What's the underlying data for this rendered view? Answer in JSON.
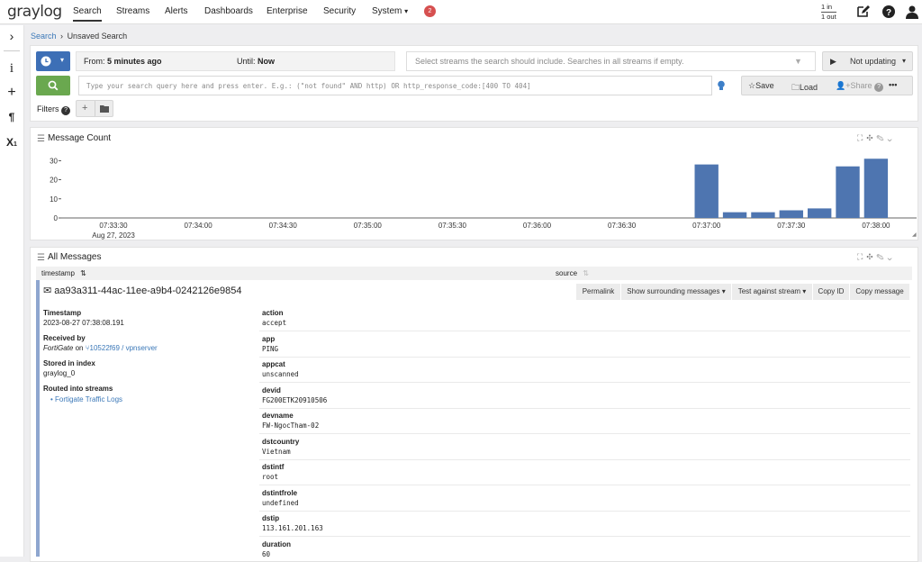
{
  "nav": {
    "logo": "graylog",
    "links": [
      "Search",
      "Streams",
      "Alerts",
      "Dashboards",
      "Enterprise",
      "Security",
      "System"
    ],
    "system_caret": "▾",
    "badge": "2",
    "throughput_in": "1 in",
    "throughput_out": "1 out"
  },
  "breadcrumb": {
    "root": "Search",
    "sep": "›",
    "current": "Unsaved Search"
  },
  "search": {
    "time_from_label": "From:",
    "time_from_value": "5 minutes ago",
    "time_until_label": "Until:",
    "time_until_value": "Now",
    "streams_placeholder": "Select streams the search should include. Searches in all streams if empty.",
    "refresh_label": "Not updating",
    "query_placeholder": "Type your search query here and press enter. E.g.: (\"not found\" AND http) OR http_response_code:[400 TO 404]",
    "save_label": "Save",
    "load_label": "Load",
    "share_label": "Share",
    "more_label": "•••",
    "filters_label": "Filters",
    "add_filter": "+"
  },
  "message_count": {
    "title": "Message Count"
  },
  "chart_data": {
    "type": "bar",
    "title": "Message Count",
    "xlabel": "",
    "ylabel": "",
    "ylim": [
      0,
      33
    ],
    "y_ticks": [
      "0",
      "10",
      "20",
      "30"
    ],
    "x_ticks": [
      "07:33:30",
      "07:34:00",
      "07:34:30",
      "07:35:00",
      "07:35:30",
      "07:36:00",
      "07:36:30",
      "07:37:00",
      "07:37:30",
      "07:38:00"
    ],
    "x_date_label": "Aug 27, 2023",
    "categories": [
      "07:37:00",
      "07:37:10",
      "07:37:20",
      "07:37:30",
      "07:37:40",
      "07:37:50",
      "07:38:00"
    ],
    "values": [
      28,
      3,
      3,
      4,
      5,
      27,
      31
    ],
    "grid": false,
    "color": "#4e75b0"
  },
  "messages": {
    "title": "All Messages",
    "col_timestamp": "timestamp",
    "col_source": "source",
    "message_id": "aa93a311-44ac-11ee-a9b4-0242126e9854",
    "actions": [
      "Permalink",
      "Show surrounding messages ▾",
      "Test against stream ▾",
      "Copy ID",
      "Copy message"
    ],
    "meta": {
      "timestamp_label": "Timestamp",
      "timestamp_value": "2023-08-27 07:38:08.191",
      "received_label": "Received by",
      "received_input": "FortiGate",
      "received_on": "on",
      "received_node": "10522f69 / vpnserver",
      "index_label": "Stored in index",
      "index_value": "graylog_0",
      "streams_label": "Routed into streams",
      "stream_name": "Fortigate Traffic Logs"
    },
    "fields": [
      {
        "key": "action",
        "value": "accept"
      },
      {
        "key": "app",
        "value": "PING"
      },
      {
        "key": "appcat",
        "value": "unscanned"
      },
      {
        "key": "devid",
        "value": "FG200ETK20910506"
      },
      {
        "key": "devname",
        "value": "FW-NgocTham-02"
      },
      {
        "key": "dstcountry",
        "value": "Vietnam"
      },
      {
        "key": "dstintf",
        "value": "root"
      },
      {
        "key": "dstintfrole",
        "value": "undefined"
      },
      {
        "key": "dstip",
        "value": "113.161.201.163"
      },
      {
        "key": "duration",
        "value": "60"
      }
    ]
  },
  "colors": {
    "accent": "#3b78b8",
    "bars": "#4e75b0",
    "search_button": "#6aa84f",
    "badge": "#d65050"
  }
}
